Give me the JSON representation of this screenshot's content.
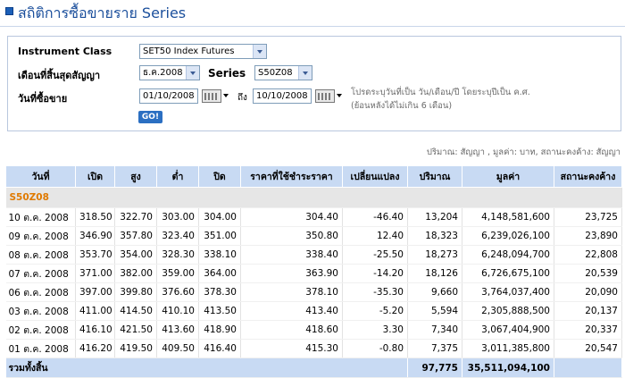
{
  "page": {
    "title": "สถิติการซื้อขายราย Series"
  },
  "form": {
    "instrument_label": "Instrument Class",
    "instrument_value": "SET50 Index Futures",
    "contract_month_label": "เดือนที่สิ้นสุดสัญญา",
    "contract_month_value": "ธ.ค.2008",
    "series_label": "Series",
    "series_value": "S50Z08",
    "trade_date_label": "วันที่ซื้อขาย",
    "date_from": "01/10/2008",
    "to_label": "ถึง",
    "date_to": "10/10/2008",
    "note_line1": "โปรดระบุวันที่เป็น วัน/เดือน/ปี โดยระบุปีเป็น ค.ศ.",
    "note_line2": "(ย้อนหลังได้ไม่เกิน 6 เดือน)",
    "go_label": "GO!"
  },
  "units_note": "ปริมาณ: สัญญา , มูลค่า: บาท, สถานะคงค้าง: สัญญา",
  "table": {
    "headers": [
      "วันที่",
      "เปิด",
      "สูง",
      "ต่ำ",
      "ปิด",
      "ราคาที่ใช้ชำระราคา",
      "เปลี่ยนแปลง",
      "ปริมาณ",
      "มูลค่า",
      "สถานะคงค้าง"
    ],
    "series_name": "S50Z08",
    "rows": [
      [
        "10 ต.ค. 2008",
        "318.50",
        "322.70",
        "303.00",
        "304.00",
        "304.40",
        "-46.40",
        "13,204",
        "4,148,581,600",
        "23,725"
      ],
      [
        "09 ต.ค. 2008",
        "346.90",
        "357.80",
        "323.40",
        "351.00",
        "350.80",
        "12.40",
        "18,323",
        "6,239,026,100",
        "23,890"
      ],
      [
        "08 ต.ค. 2008",
        "353.70",
        "354.00",
        "328.30",
        "338.10",
        "338.40",
        "-25.50",
        "18,273",
        "6,248,094,700",
        "22,808"
      ],
      [
        "07 ต.ค. 2008",
        "371.00",
        "382.00",
        "359.00",
        "364.00",
        "363.90",
        "-14.20",
        "18,126",
        "6,726,675,100",
        "20,539"
      ],
      [
        "06 ต.ค. 2008",
        "397.00",
        "399.80",
        "376.60",
        "378.30",
        "378.10",
        "-35.30",
        "9,660",
        "3,764,037,400",
        "20,090"
      ],
      [
        "03 ต.ค. 2008",
        "411.00",
        "414.50",
        "410.10",
        "413.50",
        "413.40",
        "-5.20",
        "5,594",
        "2,305,888,500",
        "20,137"
      ],
      [
        "02 ต.ค. 2008",
        "416.10",
        "421.50",
        "413.60",
        "418.90",
        "418.60",
        "3.30",
        "7,340",
        "3,067,404,900",
        "20,337"
      ],
      [
        "01 ต.ค. 2008",
        "416.20",
        "419.50",
        "409.50",
        "416.40",
        "415.30",
        "-0.80",
        "7,375",
        "3,011,385,800",
        "20,547"
      ]
    ],
    "total_label": "รวมทั้งสิ้น",
    "total_volume": "97,775",
    "total_value": "35,511,094,100"
  }
}
